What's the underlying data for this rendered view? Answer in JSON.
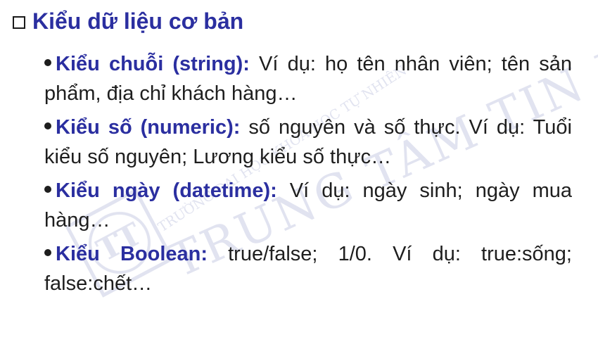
{
  "heading": {
    "text": "Kiểu dữ liệu cơ bản"
  },
  "items": [
    {
      "term": "Kiểu chuỗi (string):",
      "text": " Ví dụ: họ tên nhân viên; tên sản phẩm, địa chỉ khách hàng…"
    },
    {
      "term": "Kiểu số (numeric):",
      "text": " số nguyên và số thực. Ví dụ: Tuổi kiểu số nguyên; Lương kiểu số thực…"
    },
    {
      "term": "Kiểu ngày (datetime):",
      "text": " Ví dụ: ngày sinh; ngày mua hàng…"
    },
    {
      "term": "Kiểu Boolean:",
      "text": " true/false; 1/0. Ví dụ: true:sống; false:chết…"
    }
  ],
  "watermark": {
    "line1": "TRƯỜNG ĐẠI HỌC KHOA HỌC TỰ NHIÊN",
    "line2": "TRUNG TÂM TIN HỌC",
    "logo_letter": "TT",
    "color": "#c9cde3"
  },
  "colors": {
    "heading": "#2b2fa0",
    "term": "#2b2fa0",
    "text": "#1e1e1e"
  }
}
